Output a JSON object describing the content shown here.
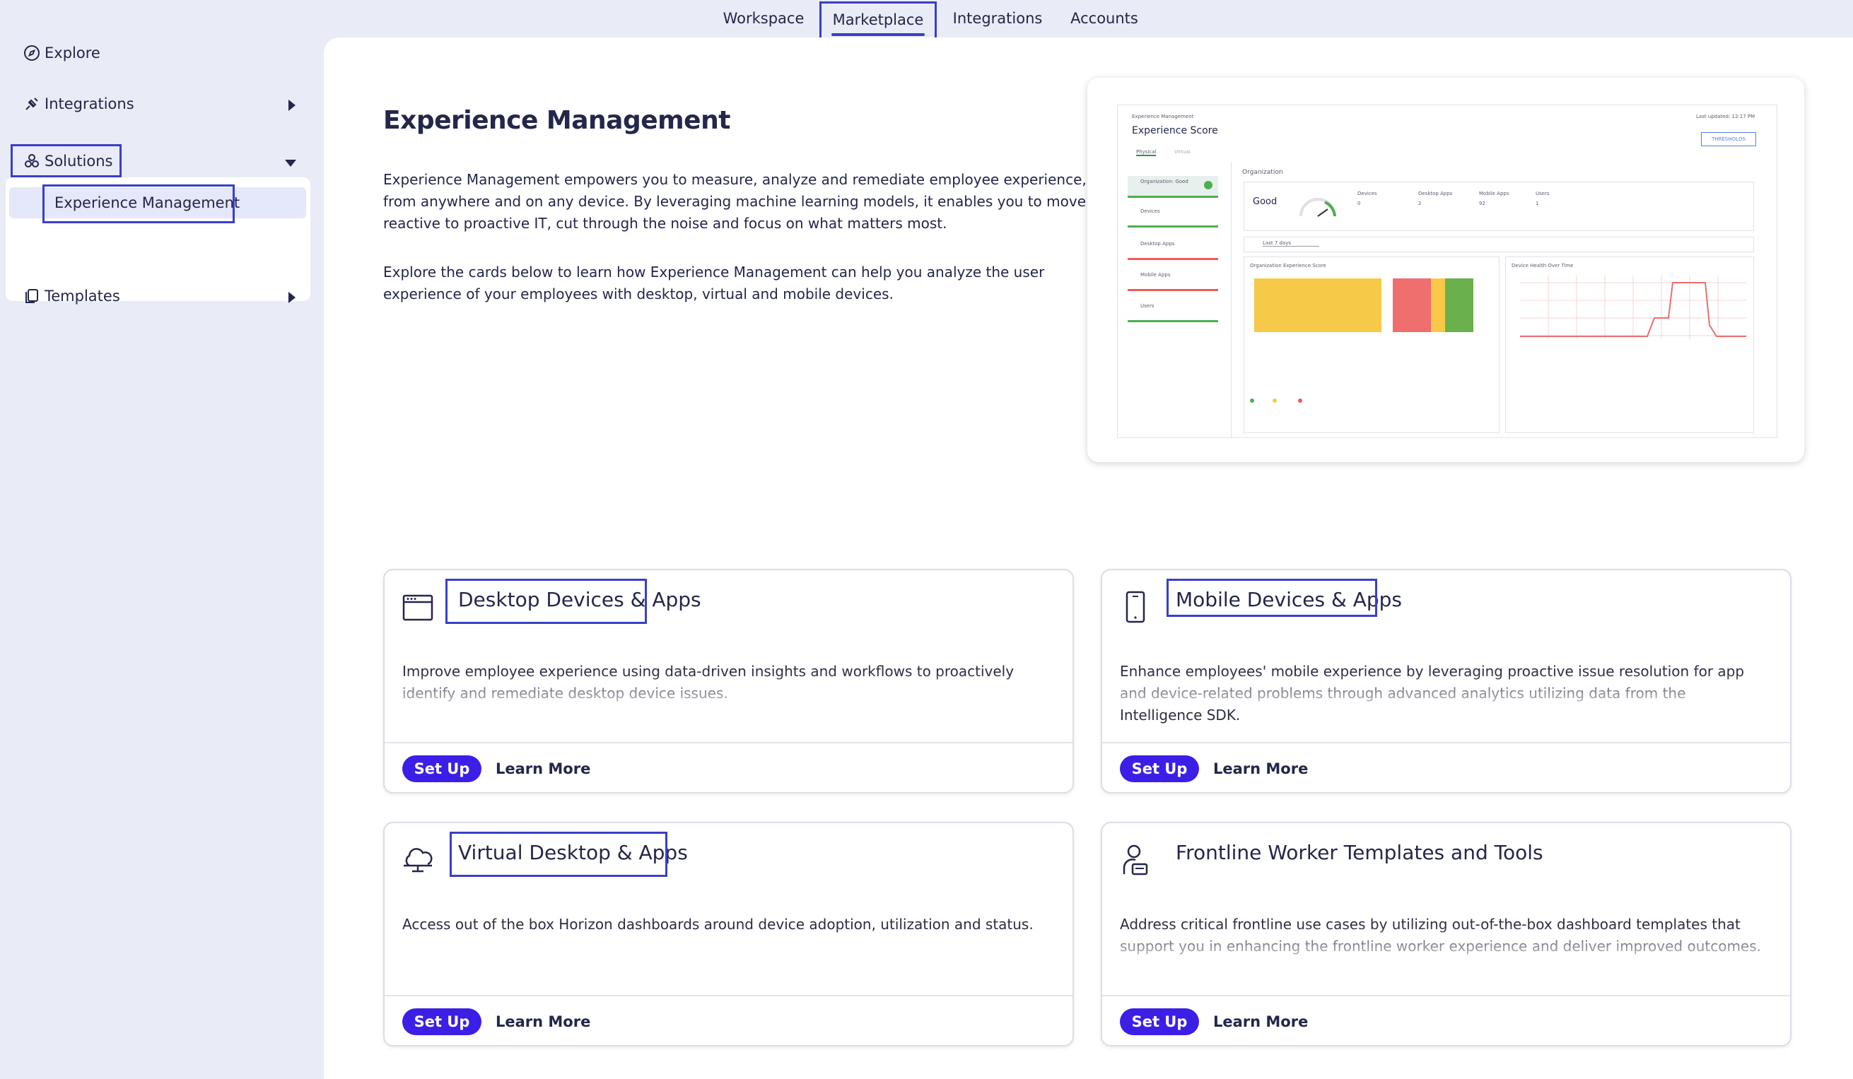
{
  "top_tabs": [
    "Workspace",
    "Marketplace",
    "Integrations",
    "Accounts"
  ],
  "active_tab": "Marketplace",
  "sidebar": {
    "explore": "Explore",
    "integrations": "Integrations",
    "solutions": "Solutions",
    "experience_management": "Experience Management",
    "templates": "Templates"
  },
  "main": {
    "title": "Experience Management",
    "para1_line1": "Experience Management empowers you to measure, analyze and remediate employee experience,",
    "para1_line2": "from anywhere and on any device. By leveraging machine learning models, it enables you to move from",
    "para1_line3": "reactive to proactive IT, cut through the noise and focus on what matters most.",
    "para2_line1": "Explore the cards below to learn how Experience Management can help you analyze the user",
    "para2_line2": "experience of your employees with desktop, virtual and mobile devices."
  },
  "preview": {
    "breadcrumb": "Experience Management",
    "title": "Experience Score",
    "updated": "Last updated: 12:17 PM",
    "threshold_btn": "THRESHOLDS",
    "tabs": [
      "Physical",
      "Virtual"
    ],
    "left_items": [
      "Organization: Good",
      "Devices",
      "Desktop Apps",
      "Mobile Apps",
      "Users"
    ],
    "org_label": "Organization",
    "org_status": "Good",
    "stats": [
      {
        "label": "Devices",
        "value": "0"
      },
      {
        "label": "Desktop Apps",
        "value": "2"
      },
      {
        "label": "Mobile Apps",
        "value": "92"
      },
      {
        "label": "Users",
        "value": "1"
      }
    ],
    "range": "Last 7 days",
    "chart1_title": "Organization Experience Score",
    "chart2_title": "Device Health Over Time",
    "colors": {
      "good": "#f7c948",
      "bad": "#ef5b5b",
      "ok": "#6ab04c",
      "line": "#ef6e6e"
    }
  },
  "cards": [
    {
      "title": "Desktop Devices & Apps",
      "icon": "desktop-window-icon",
      "desc": "Improve employee experience using data-driven insights and workflows to proactively identify and remediate desktop device issues.",
      "setup": "Set Up",
      "learn": "Learn More"
    },
    {
      "title": "Mobile Devices & Apps",
      "icon": "mobile-phone-icon",
      "desc": "Enhance employees' mobile experience by leveraging proactive issue resolution for app and device-related problems through advanced analytics utilizing data from the Intelligence SDK.",
      "setup": "Set Up",
      "learn": "Learn More"
    },
    {
      "title": "Virtual Desktop & Apps",
      "icon": "cloud-desktop-icon",
      "desc": "Access out of the box Horizon dashboards around device adoption, utilization and status.",
      "setup": "Set Up",
      "learn": "Learn More"
    },
    {
      "title": "Frontline Worker Templates and Tools",
      "icon": "frontline-worker-icon",
      "desc": "Address critical frontline use cases by utilizing out-of-the-box dashboard templates that support you in enhancing the frontline worker experience and deliver improved outcomes.",
      "setup": "Set Up",
      "learn": "Learn More"
    }
  ]
}
